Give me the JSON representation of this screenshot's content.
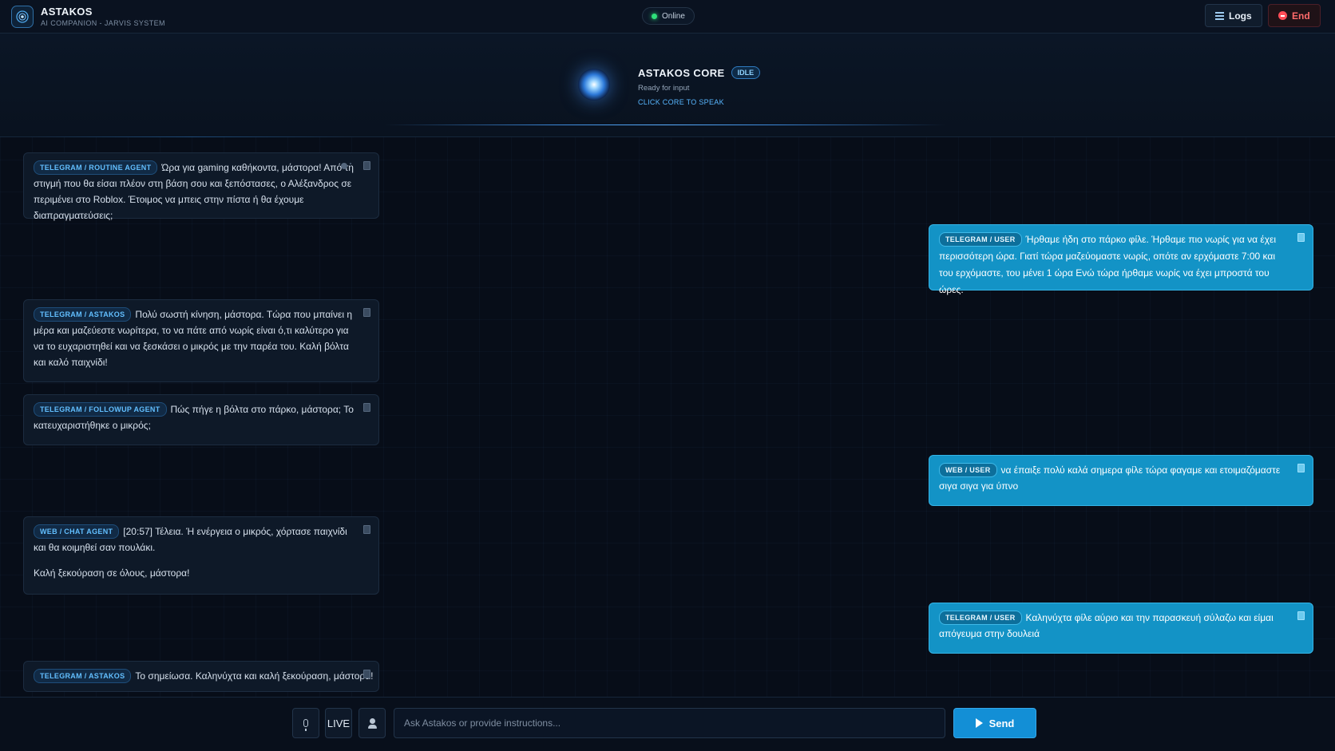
{
  "header": {
    "title": "ASTAKOS",
    "subtitle": "AI COMPANION - JARVIS SYSTEM",
    "status": "Online",
    "logs_label": "Logs",
    "end_label": "End"
  },
  "core": {
    "title": "ASTAKOS CORE",
    "badge": "IDLE",
    "status": "Ready for input",
    "cta": "CLICK CORE TO SPEAK"
  },
  "messages": [
    {
      "tag": "TELEGRAM / ROUTINE AGENT",
      "text": "Ώρα για gaming καθήκοντα, μάστορα! Από τη στιγμή που θα είσαι πλέον στη βάση σου και ξεπόστασες, ο Αλέξανδρος σε περιμένει στο Roblox. Έτοιμος να μπεις στην πίστα ή θα έχουμε διαπραγματεύσεις;"
    },
    {
      "tag": "TELEGRAM / USER",
      "text": "Ήρθαμε ήδη στο πάρκο φίλε. Ήρθαμε πιο νωρίς για να έχει περισσότερη ώρα. Γιατί τώρα μαζεύομαστε νωρίς, οπότε αν ερχόμαστε 7:00 και του ερχόμαστε, του μένει 1 ώρα Ενώ τώρα ήρθαμε νωρίς να έχει μπροστά του ώρες."
    },
    {
      "tag": "TELEGRAM / ASTAKOS",
      "text": "Πολύ σωστή κίνηση, μάστορα. Τώρα που μπαίνει η μέρα και μαζεύεστε νωρίτερα, το να πάτε από νωρίς είναι ό,τι καλύτερο για να το ευχαριστηθεί και να ξεσκάσει ο μικρός με την παρέα του. Καλή βόλτα και καλό παιχνίδι!"
    },
    {
      "tag": "TELEGRAM / FOLLOWUP AGENT",
      "text": "Πώς πήγε η βόλτα στο πάρκο, μάστορα; Το κατευχαριστήθηκε ο μικρός;"
    },
    {
      "tag": "WEB / USER",
      "text": "να έπαιξε πολύ καλά σημερα φίλε τώρα φαγαμε και ετοιμαζόμαστε σιγα σιγα για ύπνο"
    },
    {
      "tag": "WEB / CHAT AGENT",
      "text": "[20:57] Τέλεια. Ή ενέργεια ο μικρός, χόρτασε παιχνίδι και θα κοιμηθεί σαν πουλάκι.",
      "text2": "Καλή ξεκούραση σε όλους, μάστορα!"
    },
    {
      "tag": "TELEGRAM / USER",
      "text": "Καληνύχτα φίλε αύριο και την παρασκευή σύλαζω και είμαι απόγευμα στην δουλειά"
    },
    {
      "tag": "TELEGRAM / ASTAKOS",
      "text": "Το σημείωσα. Καληνύχτα και καλή ξεκούραση, μάστορα!"
    }
  ],
  "footer": {
    "live_label": "LIVE",
    "input_placeholder": "Ask Astakos or provide instructions...",
    "send_label": "Send"
  },
  "colors": {
    "background": "#070d18",
    "accent": "#138fd6",
    "user_bubble": "#1393c6",
    "online": "#2ee07a",
    "end": "#ff4d57"
  }
}
